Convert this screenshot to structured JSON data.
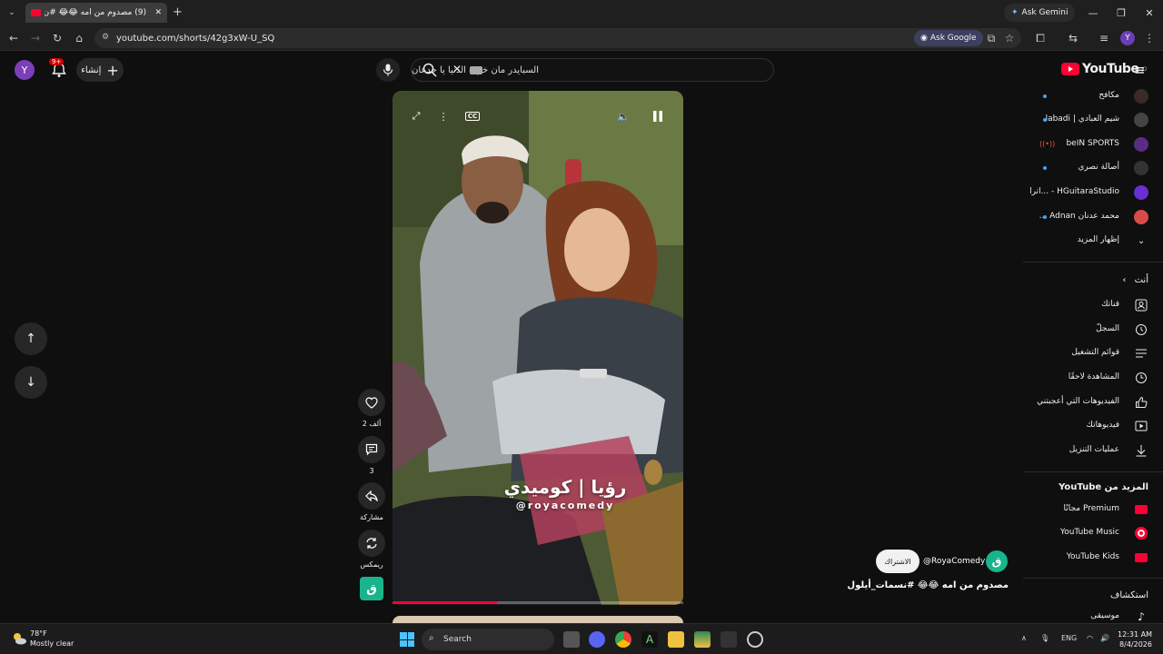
{
  "browser": {
    "tab_title": "(9) مصدوم من امه 😂😂 #ن...",
    "ask_gemini": "Ask Gemini",
    "url": "youtube.com/shorts/42g3xW-U_SQ",
    "ask_google": "Ask Google",
    "profile_initial": "Y"
  },
  "youtube": {
    "logo_text": "YouTube",
    "logo_region": "JO",
    "search_value": "السبايدر مان خرب الدنيا يا جدعان",
    "create_label": "إنشاء",
    "notif_count": "9+",
    "user_initial": "Y"
  },
  "sidebar": {
    "subscriptions": [
      {
        "label": "مكافح",
        "dot": true
      },
      {
        "label": "شيم العبادي | labadi",
        "dot": true
      },
      {
        "label": "beIN SPORTS",
        "dot": false,
        "live": true
      },
      {
        "label": "أصالة نصري",
        "dot": true
      },
      {
        "label": "HGuitaraStudio - ...اترا",
        "dot": false
      },
      {
        "label": "محمد عدنان Adnan ...",
        "dot": true
      },
      {
        "label": "إظهار المزيد",
        "dot": false
      }
    ],
    "you_header": "أنت",
    "you_items": [
      {
        "label": "قناتك",
        "icon": "user-icon"
      },
      {
        "label": "السجلّ",
        "icon": "history-icon"
      },
      {
        "label": "قوائم التشغيل",
        "icon": "playlist-icon"
      },
      {
        "label": "المشاهدة لاحقًا",
        "icon": "clock-icon"
      },
      {
        "label": "الفيديوهات التي أعجبتني",
        "icon": "like-icon"
      },
      {
        "label": "فيديوهاتك",
        "icon": "video-icon"
      },
      {
        "label": "عمليات التنزيل",
        "icon": "download-icon"
      }
    ],
    "more_header": "المزيد من YouTube",
    "more_items": [
      {
        "label": "Premium مجانًا"
      },
      {
        "label": "YouTube Music"
      },
      {
        "label": "YouTube Kids"
      }
    ],
    "explore_header": "استكشاف",
    "explore_items": [
      {
        "label": "موسيقى"
      }
    ]
  },
  "short": {
    "watermark_text": "رؤيا | كوميدي",
    "watermark_handle": "@royacomedy",
    "progress": 0.36,
    "likes": "2 ألف",
    "comments": "3",
    "share": "مشاركة",
    "remix": "ريمكس",
    "channel": "@RoyaComedy",
    "subscribe": "الاشتراك",
    "title": "مصدوم من امه 😂😂 #نسمات_أيلول"
  },
  "taskbar": {
    "temp": "78°F",
    "weather": "Mostly clear",
    "search": "Search",
    "lang": "ENG",
    "time": "12:31 AM",
    "date": "8/4/2026"
  }
}
